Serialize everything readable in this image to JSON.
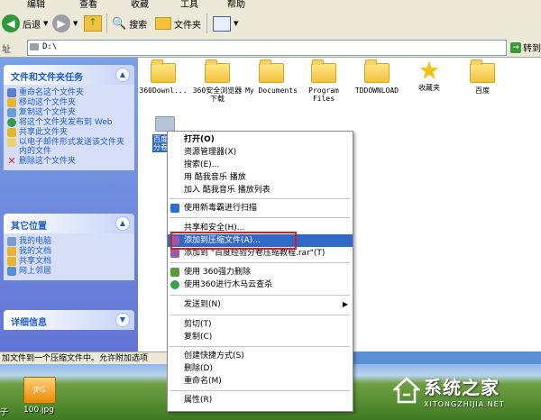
{
  "menubar": [
    "编辑",
    "查看",
    "收藏",
    "工具",
    "帮助"
  ],
  "toolbar": {
    "back": "后退",
    "search": "搜索",
    "folders": "文件夹"
  },
  "address": {
    "label": "址",
    "value": "D:\\",
    "go": "转到"
  },
  "task_panel": {
    "title": "文件和文件夹任务",
    "items": [
      "重命名这个文件夹",
      "移动这个文件夹",
      "复制这个文件夹",
      "将这个文件夹发布到 Web",
      "共享此文件夹",
      "以电子邮件形式发送该文件夹内的文件",
      "删除这个文件夹"
    ]
  },
  "other_panel": {
    "title": "其它位置",
    "items": [
      "我的电脑",
      "我的文档",
      "共享文档",
      "网上邻居"
    ]
  },
  "details_panel": {
    "title": "详细信息"
  },
  "files": [
    {
      "label": "360Downl..."
    },
    {
      "label": "360安全浏览器下载"
    },
    {
      "label": "My Documents"
    },
    {
      "label": "Program Files"
    },
    {
      "label": "TDDOWNLOAD"
    },
    {
      "label": "收藏夹"
    },
    {
      "label": "百度"
    }
  ],
  "selected_item": {
    "label": "百度经验分卷压缩"
  },
  "context_menu": {
    "items": [
      {
        "label": "打开(O)"
      },
      {
        "label": "资源管理器(X)"
      },
      {
        "label": "搜索(E)..."
      },
      {
        "label": "用 酷我音乐 播放"
      },
      {
        "label": "加入 酷我音乐 播放列表"
      },
      {
        "label": "使用新毒霸进行扫描"
      },
      {
        "label": "共享和安全(H)..."
      },
      {
        "label": "添加到压缩文件(A)..."
      },
      {
        "label": "添加到 \"百度经验分卷压缩教程.rar\"(T)"
      },
      {
        "label": "使用 360强力删除"
      },
      {
        "label": "使用360进行木马云查杀"
      },
      {
        "label": "发送到(N)"
      },
      {
        "label": "剪切(T)"
      },
      {
        "label": "复制(C)"
      },
      {
        "label": "创建快捷方式(S)"
      },
      {
        "label": "删除(D)"
      },
      {
        "label": "重命名(M)"
      },
      {
        "label": "属性(R)"
      }
    ]
  },
  "status": "加文件到一个压缩文件中。允许附加选项",
  "desktop": {
    "icon_label": "100.jpg",
    "left_label": "子",
    "icon_badge": "JPG"
  },
  "watermark": {
    "text": "系统之家",
    "sub": "XITONGZHIJIA.NET"
  },
  "colors": {
    "selection": "#316ac5",
    "highlight_box": "#d81e1e",
    "task_link": "#215dc6"
  }
}
